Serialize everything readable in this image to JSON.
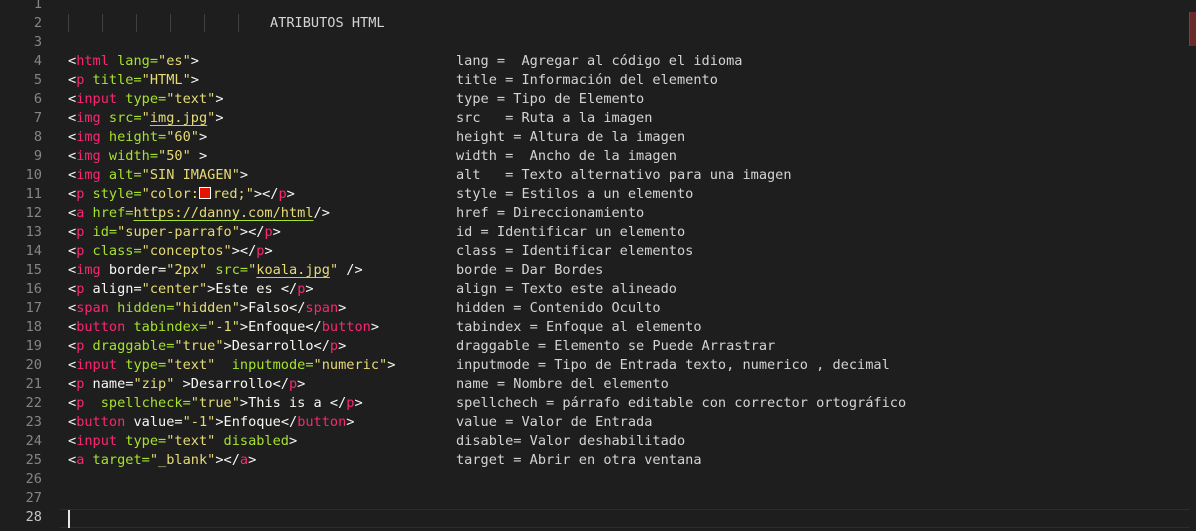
{
  "editor": {
    "line_numbers": [
      "1",
      "2",
      "3",
      "4",
      "5",
      "6",
      "7",
      "8",
      "9",
      "10",
      "11",
      "12",
      "13",
      "14",
      "15",
      "16",
      "17",
      "18",
      "19",
      "20",
      "21",
      "22",
      "23",
      "24",
      "25",
      "26",
      "27",
      "28"
    ],
    "title_line": "ATRIBUTOS HTML",
    "lines": [
      {
        "code": [
          [
            "<",
            "pn"
          ],
          [
            "html",
            "tg"
          ],
          [
            " lang=",
            "at"
          ],
          [
            "\"es\"",
            "st"
          ],
          [
            ">",
            "pn"
          ]
        ],
        "comment": "lang =  Agregar al código el idioma"
      },
      {
        "code": [
          [
            "<",
            "pn"
          ],
          [
            "p",
            "tg"
          ],
          [
            " title=",
            "at"
          ],
          [
            "\"HTML\"",
            "st"
          ],
          [
            ">",
            "pn"
          ]
        ],
        "comment": "title = Información del elemento"
      },
      {
        "code": [
          [
            "<",
            "pn"
          ],
          [
            "input",
            "tg"
          ],
          [
            " type=",
            "at"
          ],
          [
            "\"text\"",
            "st"
          ],
          [
            ">",
            "pn"
          ]
        ],
        "comment": "type = Tipo de Elemento"
      },
      {
        "code": [
          [
            "<",
            "pn"
          ],
          [
            "img",
            "tg"
          ],
          [
            " src=",
            "at"
          ],
          [
            "\"",
            "st"
          ],
          [
            "img.jpg",
            "st ul"
          ],
          [
            "\"",
            "st"
          ],
          [
            ">",
            "pn"
          ]
        ],
        "comment": "src   = Ruta a la imagen"
      },
      {
        "code": [
          [
            "<",
            "pn"
          ],
          [
            "img",
            "tg"
          ],
          [
            " height=",
            "at"
          ],
          [
            "\"60\"",
            "st"
          ],
          [
            ">",
            "pn"
          ]
        ],
        "comment": "height = Altura de la imagen"
      },
      {
        "code": [
          [
            "<",
            "pn"
          ],
          [
            "img",
            "tg"
          ],
          [
            " width=",
            "at"
          ],
          [
            "\"50\"",
            "st"
          ],
          [
            " >",
            "pn"
          ]
        ],
        "comment": "width =  Ancho de la imagen"
      },
      {
        "code": [
          [
            "<",
            "pn"
          ],
          [
            "img",
            "tg"
          ],
          [
            " alt=",
            "at"
          ],
          [
            "\"SIN IMAGEN\"",
            "st"
          ],
          [
            ">",
            "pn"
          ]
        ],
        "comment": "alt   = Texto alternativo para una imagen"
      },
      {
        "code": [
          [
            "<",
            "pn"
          ],
          [
            "p",
            "tg"
          ],
          [
            " style=",
            "at"
          ],
          [
            "\"color:",
            "st"
          ],
          [
            "",
            "swatch"
          ],
          [
            "red;\"",
            "st"
          ],
          [
            "></",
            "pn"
          ],
          [
            "p",
            "tg"
          ],
          [
            ">",
            "pn"
          ]
        ],
        "comment": "style = Estilos a un elemento"
      },
      {
        "code": [
          [
            "<",
            "pn"
          ],
          [
            "a",
            "tg"
          ],
          [
            " href=",
            "at"
          ],
          [
            "https://danny.com/html",
            "st ul"
          ],
          [
            "/>",
            "pn"
          ]
        ],
        "comment": "href = Direccionamiento"
      },
      {
        "code": [
          [
            "<",
            "pn"
          ],
          [
            "p",
            "tg"
          ],
          [
            " id=",
            "at"
          ],
          [
            "\"super-parrafo\"",
            "st"
          ],
          [
            "></",
            "pn"
          ],
          [
            "p",
            "tg"
          ],
          [
            ">",
            "pn"
          ]
        ],
        "comment": "id = Identificar un elemento"
      },
      {
        "code": [
          [
            "<",
            "pn"
          ],
          [
            "p",
            "tg"
          ],
          [
            " class=",
            "at"
          ],
          [
            "\"conceptos\"",
            "st"
          ],
          [
            "></",
            "pn"
          ],
          [
            "p",
            "tg"
          ],
          [
            ">",
            "pn"
          ]
        ],
        "comment": "class = Identificar elementos"
      },
      {
        "code": [
          [
            "<",
            "pn"
          ],
          [
            "img",
            "tg"
          ],
          [
            " border=",
            "tx"
          ],
          [
            "\"2px\"",
            "st"
          ],
          [
            " src=",
            "at"
          ],
          [
            "\"",
            "st"
          ],
          [
            "koala.jpg",
            "st ul"
          ],
          [
            "\"",
            "st"
          ],
          [
            " />",
            "pn"
          ]
        ],
        "comment": "borde = Dar Bordes"
      },
      {
        "code": [
          [
            "<",
            "pn"
          ],
          [
            "p",
            "tg"
          ],
          [
            " align=",
            "tx"
          ],
          [
            "\"center\"",
            "st"
          ],
          [
            ">Este es </",
            "pn"
          ],
          [
            "p",
            "tg"
          ],
          [
            ">",
            "pn"
          ]
        ],
        "comment": "align = Texto este alineado"
      },
      {
        "code": [
          [
            "<",
            "pn"
          ],
          [
            "span",
            "tg"
          ],
          [
            " hidden=",
            "at"
          ],
          [
            "\"hidden\"",
            "st"
          ],
          [
            ">Falso</",
            "pn"
          ],
          [
            "span",
            "tg"
          ],
          [
            ">",
            "pn"
          ]
        ],
        "comment": "hidden = Contenido Oculto"
      },
      {
        "code": [
          [
            "<",
            "pn"
          ],
          [
            "button",
            "tg"
          ],
          [
            " tabindex=",
            "at"
          ],
          [
            "\"-1\"",
            "st"
          ],
          [
            ">Enfoque</",
            "pn"
          ],
          [
            "button",
            "tg"
          ],
          [
            ">",
            "pn"
          ]
        ],
        "comment": "tabindex = Enfoque al elemento"
      },
      {
        "code": [
          [
            "<",
            "pn"
          ],
          [
            "p",
            "tg"
          ],
          [
            " draggable=",
            "at"
          ],
          [
            "\"true\"",
            "st"
          ],
          [
            ">Desarrollo</",
            "pn"
          ],
          [
            "p",
            "tg"
          ],
          [
            ">",
            "pn"
          ]
        ],
        "comment": "draggable = Elemento se Puede Arrastrar"
      },
      {
        "code": [
          [
            "<",
            "pn"
          ],
          [
            "input",
            "tg"
          ],
          [
            " type=",
            "at"
          ],
          [
            "\"text\"",
            "st"
          ],
          [
            "  inputmode=",
            "at"
          ],
          [
            "\"numeric\"",
            "st"
          ],
          [
            ">",
            "pn"
          ]
        ],
        "comment": "inputmode = Tipo de Entrada texto, numerico , decimal"
      },
      {
        "code": [
          [
            "<",
            "pn"
          ],
          [
            "p",
            "tg"
          ],
          [
            " name=",
            "tx"
          ],
          [
            "\"zip\"",
            "st"
          ],
          [
            " >Desarrollo</",
            "pn"
          ],
          [
            "p",
            "tg"
          ],
          [
            ">",
            "pn"
          ]
        ],
        "comment": "name = Nombre del elemento"
      },
      {
        "code": [
          [
            "<",
            "pn"
          ],
          [
            "p",
            "tg"
          ],
          [
            "  spellcheck=",
            "at"
          ],
          [
            "\"true\"",
            "st"
          ],
          [
            ">This is a </",
            "pn"
          ],
          [
            "p",
            "tg"
          ],
          [
            ">",
            "pn"
          ]
        ],
        "comment": "spellchech = párrafo editable con corrector ortográfico"
      },
      {
        "code": [
          [
            "<",
            "pn"
          ],
          [
            "button",
            "tg"
          ],
          [
            " value=",
            "tx"
          ],
          [
            "\"-1\"",
            "st"
          ],
          [
            ">Enfoque</",
            "pn"
          ],
          [
            "button",
            "tg"
          ],
          [
            ">",
            "pn"
          ]
        ],
        "comment": "value = Valor de Entrada"
      },
      {
        "code": [
          [
            "<",
            "pn"
          ],
          [
            "input",
            "tg"
          ],
          [
            " type=",
            "at"
          ],
          [
            "\"text\"",
            "st"
          ],
          [
            " disabled",
            "at"
          ],
          [
            ">",
            "pn"
          ]
        ],
        "comment": "disable= Valor deshabilitado"
      },
      {
        "code": [
          [
            "<",
            "pn"
          ],
          [
            "a",
            "tg"
          ],
          [
            " target=",
            "at"
          ],
          [
            "\"_blank\"",
            "st"
          ],
          [
            "></",
            "pn"
          ],
          [
            "a",
            "tg"
          ],
          [
            ">",
            "pn"
          ]
        ],
        "comment": "target = Abrir en otra ventana"
      }
    ],
    "colors": {
      "background": "#1e1e1e",
      "tag": "#f92672",
      "attribute": "#a6e22e",
      "string": "#e6db74",
      "text": "#f8f8f2",
      "line_number": "#858585",
      "color_swatch": "#e51400"
    }
  }
}
